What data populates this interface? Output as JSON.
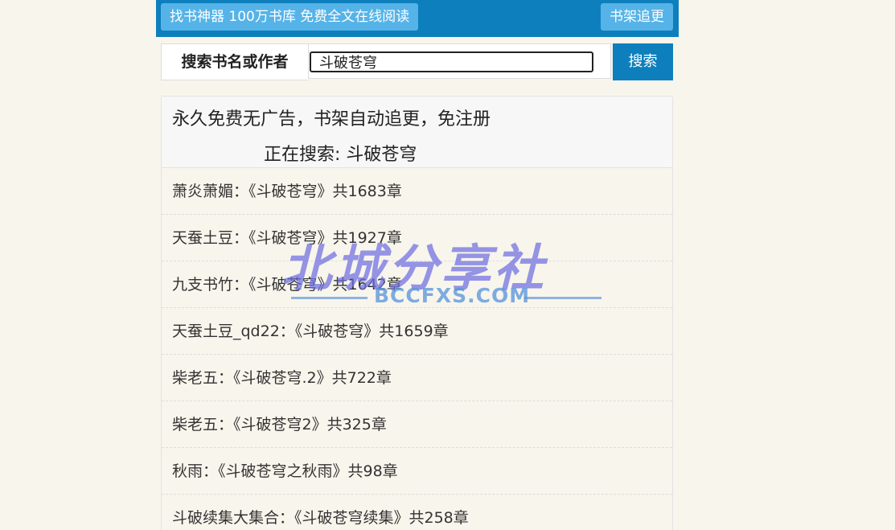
{
  "topbar": {
    "left_button": "找书神器 100万书库 免费全文在线阅读",
    "right_button": "书架追更"
  },
  "search": {
    "label": "搜索书名或作者",
    "value": "斗破苍穹",
    "button": "搜索"
  },
  "panel": {
    "slogan": "永久免费无广告，书架自动追更，免注册",
    "searching": "正在搜索: 斗破苍穹"
  },
  "results": [
    "萧炎萧媚：《斗破苍穹》共1683章",
    "天蚕土豆：《斗破苍穹》共1927章",
    "九支书竹：《斗破苍穹》共1642章",
    "天蚕土豆_qd22：《斗破苍穹》共1659章",
    "柴老五：《斗破苍穹.2》共722章",
    "柴老五：《斗破苍穹2》共325章",
    "秋雨：《斗破苍穹之秋雨》共98章",
    "斗破续集大集合：《斗破苍穹续集》共258章"
  ],
  "watermark": {
    "title": "北城分享社",
    "url": "BCCFXS.COM"
  }
}
